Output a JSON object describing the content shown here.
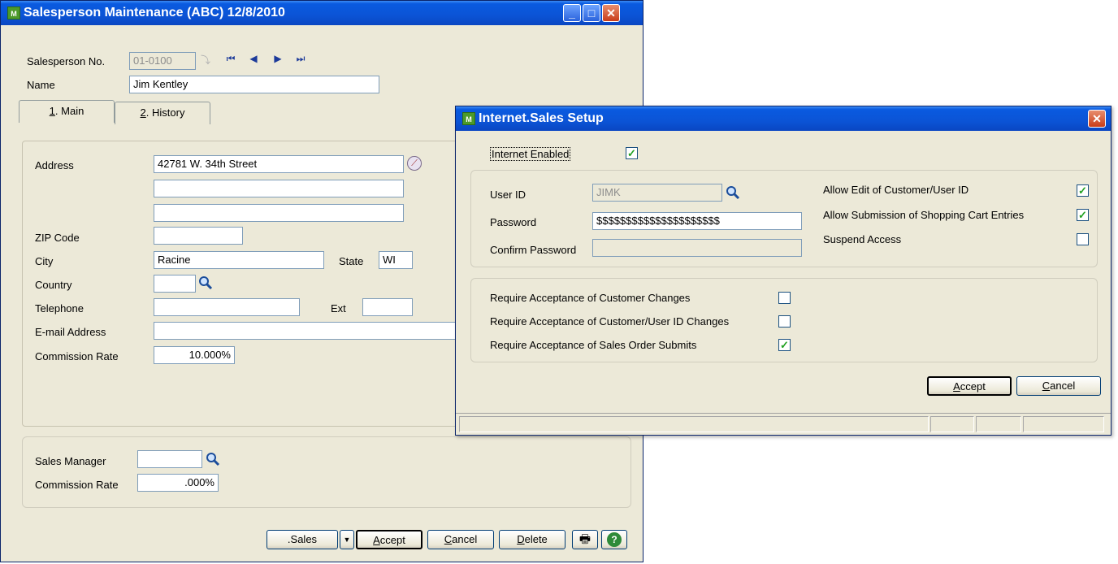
{
  "main_window": {
    "title": "Salesperson Maintenance (ABC) 12/8/2010",
    "salesperson_no_label": "Salesperson No.",
    "salesperson_no_value": "01-0100",
    "name_label": "Name",
    "name_value": "Jim Kentley",
    "tabs": [
      {
        "key": "1",
        "label": ". Main"
      },
      {
        "key": "2",
        "label": ". History"
      }
    ],
    "address_label": "Address",
    "address_lines": [
      "42781 W. 34th Street",
      "",
      ""
    ],
    "zip_label": "ZIP Code",
    "zip_value": "",
    "city_label": "City",
    "city_value": "Racine",
    "state_label": "State",
    "state_value": "WI",
    "country_label": "Country",
    "country_value": "",
    "telephone_label": "Telephone",
    "telephone_value": "",
    "ext_label": "Ext",
    "ext_value": "",
    "email_label": "E-mail Address",
    "email_value": "",
    "commission_rate_label": "Commission Rate",
    "commission_rate_value": "10.000%",
    "sales_manager_label": "Sales Manager",
    "sales_manager_value": "",
    "manager_commission_label": "Commission Rate",
    "manager_commission_value": ".000%",
    "buttons": {
      "sales": ".Sales",
      "accept_u": "A",
      "accept_rest": "ccept",
      "cancel_u": "C",
      "cancel_rest": "ancel",
      "delete_u": "D",
      "delete_rest": "elete"
    }
  },
  "dialog": {
    "title": "Internet.Sales Setup",
    "internet_enabled_label": "Internet Enabled",
    "internet_enabled": true,
    "user_id_label": "User ID",
    "user_id_value": "JIMK",
    "password_label": "Password",
    "password_value": "$$$$$$$$$$$$$$$$$$$$$",
    "confirm_password_label": "Confirm Password",
    "confirm_password_value": "",
    "allow_edit_label": "Allow Edit of Customer/User ID",
    "allow_edit": true,
    "allow_submission_label": "Allow Submission of Shopping Cart Entries",
    "allow_submission": true,
    "suspend_access_label": "Suspend Access",
    "suspend_access": false,
    "require_customer_changes_label": "Require Acceptance of Customer Changes",
    "require_customer_changes": false,
    "require_userid_changes_label": "Require Acceptance of Customer/User ID Changes",
    "require_userid_changes": false,
    "require_sales_order_label": "Require Acceptance of Sales Order Submits",
    "require_sales_order": true,
    "accept_u": "A",
    "accept_rest": "ccept",
    "cancel_u": "C",
    "cancel_rest": "ancel"
  },
  "colors": {
    "title_bar": "#0b54d6",
    "window_bg": "#ece9d8",
    "check_mark": "#21a121"
  },
  "icons": [
    "app-icon",
    "minimize-icon",
    "maximize-icon",
    "close-icon",
    "first-record-icon",
    "previous-record-icon",
    "next-record-icon",
    "last-record-icon",
    "lookup-icon",
    "address-compass-icon",
    "print-icon",
    "help-icon",
    "dropdown-arrow-icon"
  ]
}
